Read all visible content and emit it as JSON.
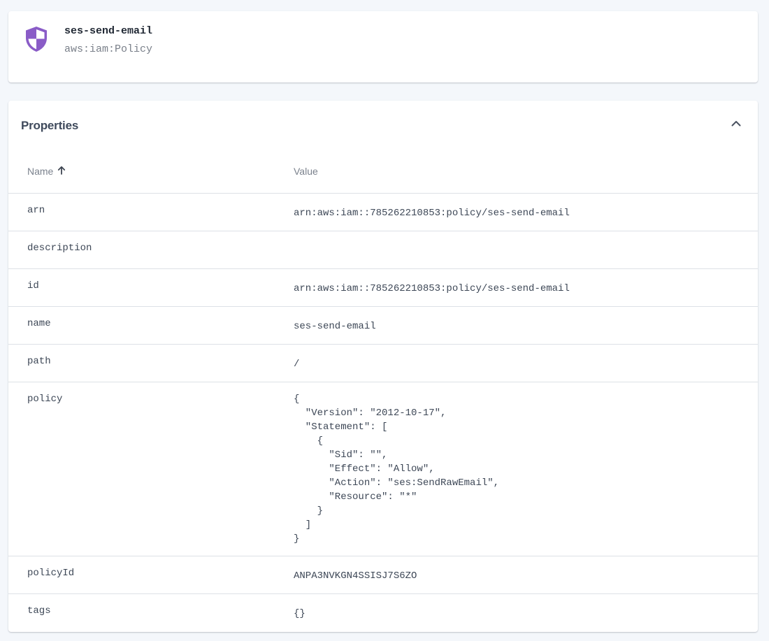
{
  "resource": {
    "name": "ses-send-email",
    "type": "aws:iam:Policy",
    "icon": "shield-icon",
    "icon_color": "#8a5cc7"
  },
  "properties": {
    "title": "Properties",
    "collapse_icon": "chevron-up-icon",
    "columns": {
      "name": "Name",
      "value": "Value",
      "sort_icon": "arrow-up-icon"
    },
    "rows": [
      {
        "name": "arn",
        "value": "arn:aws:iam::785262210853:policy/ses-send-email"
      },
      {
        "name": "description",
        "value": ""
      },
      {
        "name": "id",
        "value": "arn:aws:iam::785262210853:policy/ses-send-email"
      },
      {
        "name": "name",
        "value": "ses-send-email"
      },
      {
        "name": "path",
        "value": "/"
      },
      {
        "name": "policy",
        "value": "{\n  \"Version\": \"2012-10-17\",\n  \"Statement\": [\n    {\n      \"Sid\": \"\",\n      \"Effect\": \"Allow\",\n      \"Action\": \"ses:SendRawEmail\",\n      \"Resource\": \"*\"\n    }\n  ]\n}"
      },
      {
        "name": "policyId",
        "value": "ANPA3NVKGN4SSISJ7S6ZO"
      },
      {
        "name": "tags",
        "value": "{}"
      }
    ]
  }
}
